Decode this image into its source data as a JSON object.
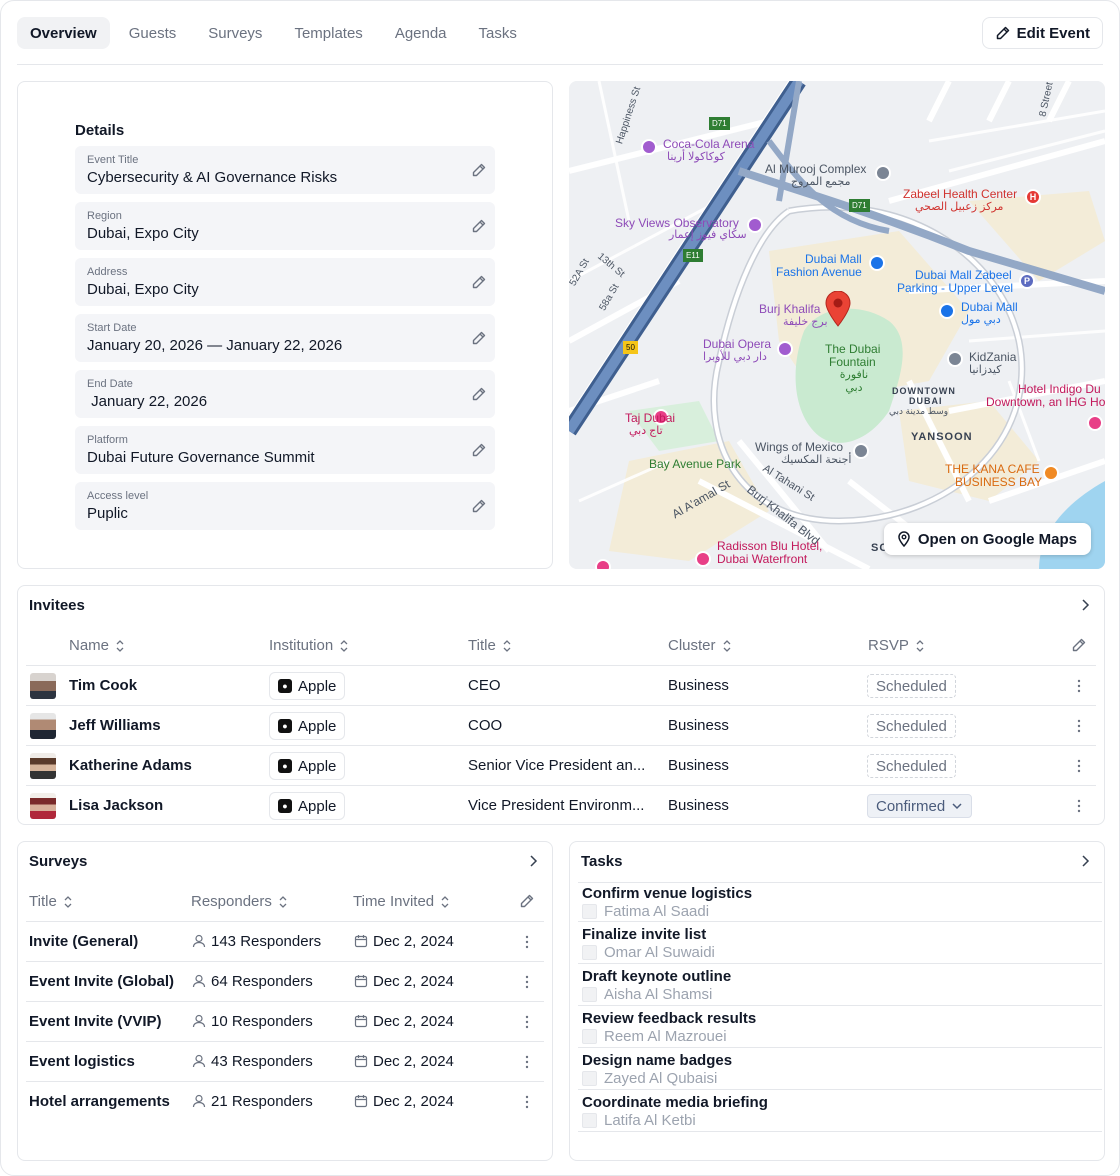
{
  "tabs": [
    "Overview",
    "Guests",
    "Surveys",
    "Templates",
    "Agenda",
    "Tasks"
  ],
  "edit_event_label": "Edit Event",
  "details": {
    "title": "Details",
    "fields": [
      {
        "label": "Event Title",
        "value": "Cybersecurity & AI Governance Risks"
      },
      {
        "label": "Region",
        "value": "Dubai, Expo City"
      },
      {
        "label": "Address",
        "value": "Dubai, Expo City"
      },
      {
        "label": "Start Date",
        "value": "January 20, 2026 — January 22, 2026"
      },
      {
        "label": "End Date",
        "value": " January 22, 2026"
      },
      {
        "label": "Platform",
        "value": "Dubai Future Governance Summit"
      },
      {
        "label": "Access level",
        "value": "Puplic"
      }
    ]
  },
  "map": {
    "open_label": "Open on Google Maps",
    "labels": {
      "coca_cola": "Coca-Cola Arena",
      "coca_cola_ar": "كوكاكولا أرينا",
      "al_murooj": "Al Murooj Complex",
      "al_murooj_ar": "مجمع المروج",
      "zabeel": "Zabeel Health Center",
      "zabeel_ar": "مركز زعبيل الصحي",
      "sky_views": "Sky Views Observatory",
      "sky_views_ar": "سكاي فيوز إعمار",
      "dubai_mall_fashion_1": "Dubai Mall",
      "dubai_mall_fashion_2": "Fashion Avenue",
      "parking_1": "Dubai Mall Zabeel",
      "parking_2": "Parking - Upper Level",
      "burj": "Burj Khalifa",
      "burj_ar": "برج خليفة",
      "dubai_mall": "Dubai Mall",
      "dubai_mall_ar": "دبي مول",
      "opera": "Dubai Opera",
      "opera_ar": "دار دبي للأوبرا",
      "fountain_1": "The Dubai",
      "fountain_2": "Fountain",
      "fountain_ar": "نافورة دبي",
      "kidzania": "KidZania",
      "kidzania_ar": "كيدزانيا",
      "downtown_1": "DOWNTOWN",
      "downtown_2": "DUBAI",
      "downtown_ar": "وسط مدينة دبي",
      "hotel_indigo_1": "Hotel Indigo Du",
      "hotel_indigo_2": "Downtown, an IHG Ho",
      "taj": "Taj Dubai",
      "taj_ar": "تاج دبي",
      "yansoon": "YANSOON",
      "wings": "Wings of Mexico",
      "wings_ar": "أجنحة المكسيك",
      "bay_avenue": "Bay Avenue Park",
      "kana_1": "THE KANA CAFE",
      "kana_2": "BUSINESS BAY",
      "radisson_1": "Radisson Blu Hotel,",
      "radisson_2": "Dubai Waterfront",
      "happiness": "Happiness St",
      "st_52a": "52A St",
      "st_13th": "13th St",
      "st_58a": "58a St",
      "st_8th": "8 Street",
      "al_aamal": "Al A'amal St",
      "al_tahani": "Al Tahani St",
      "burj_blvd": "Burj Khalifa Blvd",
      "d71": "D71",
      "e11": "E11",
      "r50": "50",
      "sc": "SC"
    }
  },
  "invitees": {
    "title": "Invitees",
    "columns": [
      "Name",
      "Institution",
      "Title",
      "Cluster",
      "RSVP"
    ],
    "rows": [
      {
        "name": "Tim Cook",
        "institution": "Apple",
        "title": "CEO",
        "cluster": "Business",
        "rsvp": "Scheduled",
        "avatar_color": "#8a6a5a"
      },
      {
        "name": "Jeff Williams",
        "institution": "Apple",
        "title": "COO",
        "cluster": "Business",
        "rsvp": "Scheduled",
        "avatar_color": "#4a5a6a"
      },
      {
        "name": "Katherine Adams",
        "institution": "Apple",
        "title": "Senior Vice President an...",
        "cluster": "Business",
        "rsvp": "Scheduled",
        "avatar_color": "#5a3a2a"
      },
      {
        "name": "Lisa Jackson",
        "institution": "Apple",
        "title": "Vice President Environm...",
        "cluster": "Business",
        "rsvp": "Confirmed",
        "avatar_color": "#7a2a2a"
      }
    ]
  },
  "surveys": {
    "title": "Surveys",
    "columns": [
      "Title",
      "Responders",
      "Time Invited"
    ],
    "rows": [
      {
        "title": "Invite (General)",
        "responders": "143 Responders",
        "time": "Dec 2, 2024"
      },
      {
        "title": "Event Invite (Global)",
        "responders": "64 Responders",
        "time": "Dec 2, 2024"
      },
      {
        "title": "Event Invite (VVIP)",
        "responders": "10 Responders",
        "time": "Dec 2, 2024"
      },
      {
        "title": "Event logistics",
        "responders": "43 Responders",
        "time": "Dec 2, 2024"
      },
      {
        "title": "Hotel arrangements",
        "responders": "21 Responders",
        "time": "Dec 2, 2024"
      }
    ]
  },
  "tasks": {
    "title": "Tasks",
    "items": [
      {
        "title": "Confirm venue logistics",
        "assignee": "Fatima Al Saadi"
      },
      {
        "title": "Finalize invite list",
        "assignee": "Omar Al Suwaidi"
      },
      {
        "title": "Draft keynote outline",
        "assignee": "Aisha Al Shamsi"
      },
      {
        "title": "Review feedback results",
        "assignee": "Reem Al Mazrouei"
      },
      {
        "title": "Design name badges",
        "assignee": "Zayed Al Qubaisi"
      },
      {
        "title": "Coordinate media briefing",
        "assignee": "Latifa Al Ketbi"
      }
    ]
  },
  "colors": {
    "brand_dark": "#111827",
    "muted": "#6b7280",
    "border": "#e5e7eb",
    "field_bg": "#f4f5f8",
    "map_park": "#c9ead0",
    "map_highway": "#5b7fb0",
    "map_water": "#9fd4f0",
    "map_sand": "#f3ecd8"
  }
}
